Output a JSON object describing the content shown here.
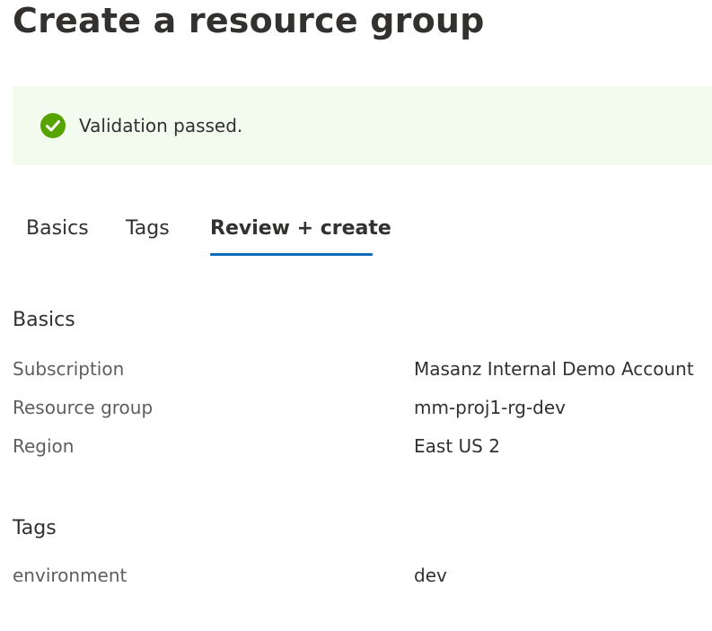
{
  "page": {
    "title": "Create a resource group"
  },
  "banner": {
    "icon": "check-circle-icon",
    "message": "Validation passed.",
    "background": "#f3fbee",
    "icon_color": "#57a300"
  },
  "tabs": [
    {
      "label": "Basics",
      "selected": false
    },
    {
      "label": "Tags",
      "selected": false
    },
    {
      "label": "Review + create",
      "selected": true
    }
  ],
  "accent_color": "#0f6cbd",
  "basics": {
    "heading": "Basics",
    "rows": [
      {
        "label": "Subscription",
        "value": "Masanz Internal Demo Account"
      },
      {
        "label": "Resource group",
        "value": "mm-proj1-rg-dev"
      },
      {
        "label": "Region",
        "value": "East US 2"
      }
    ]
  },
  "tags": {
    "heading": "Tags",
    "rows": [
      {
        "label": "environment",
        "value": "dev"
      }
    ]
  }
}
